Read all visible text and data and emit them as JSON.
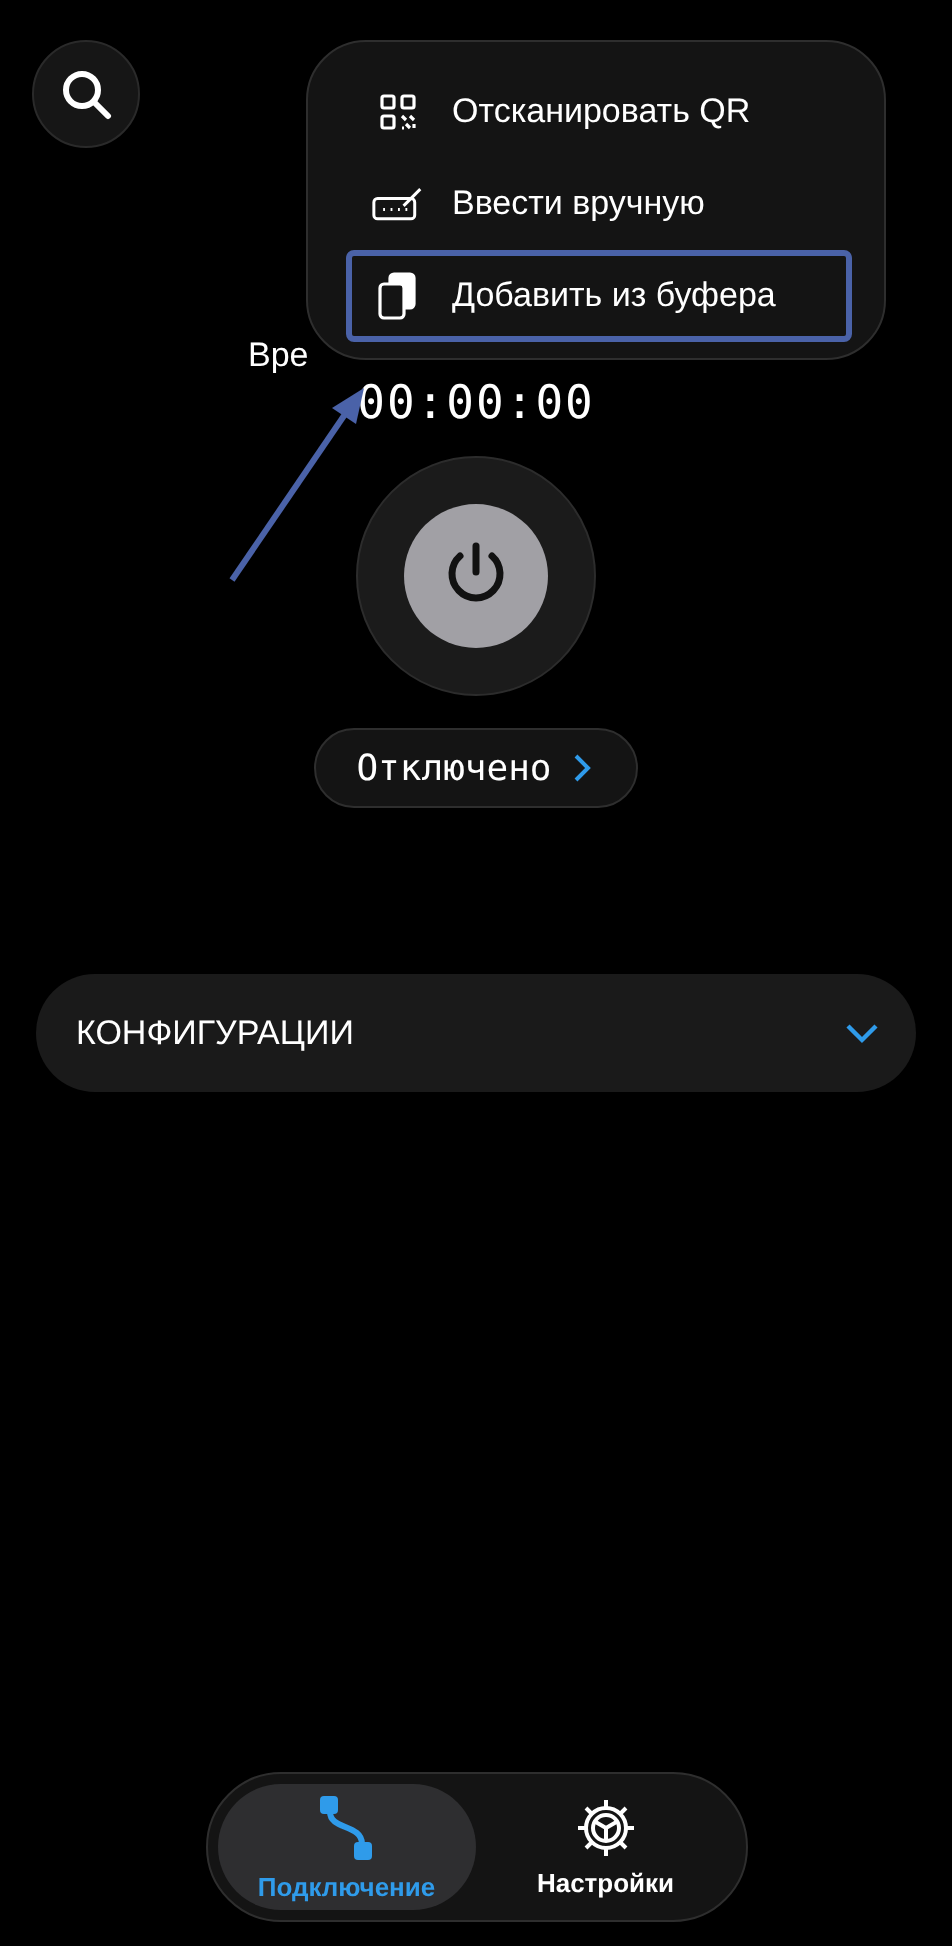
{
  "menu": {
    "items": [
      {
        "kind": "qr",
        "label": "Отсканировать QR",
        "selected": false
      },
      {
        "kind": "keyboard",
        "label": "Ввести вручную",
        "selected": false
      },
      {
        "kind": "clipboard",
        "label": "Добавить из буфера",
        "selected": true
      }
    ]
  },
  "timer": {
    "label": "Вре",
    "value": "00:00:00"
  },
  "power": {
    "on": false
  },
  "status": {
    "label": "Отключено"
  },
  "configurations": {
    "title": "КОНФИГУРАЦИИ",
    "expanded": false
  },
  "nav": [
    {
      "kind": "connection",
      "label": "Подключение",
      "selected": true
    },
    {
      "kind": "settings",
      "label": "Настройки",
      "selected": false
    }
  ]
}
